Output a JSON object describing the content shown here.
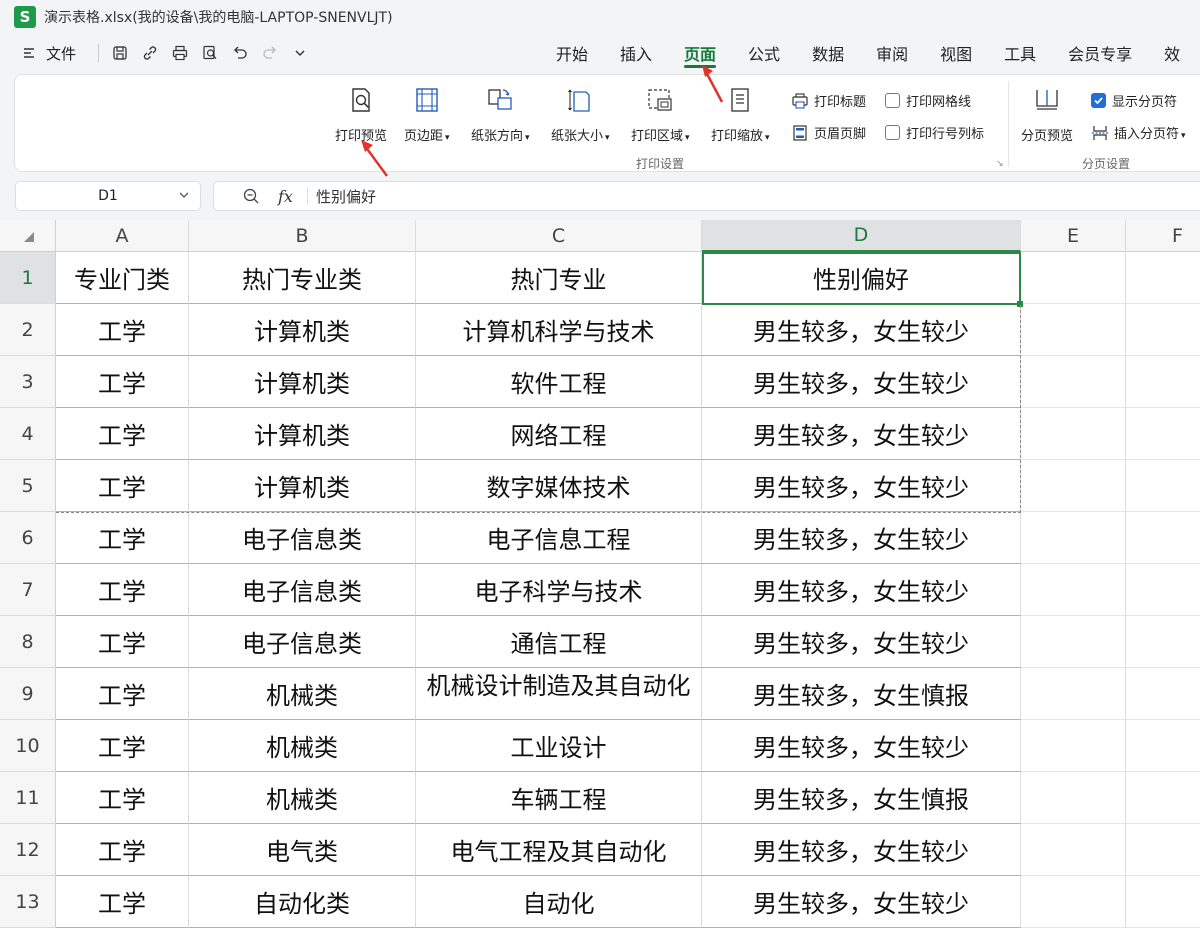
{
  "window": {
    "app_letter": "S",
    "title": "演示表格.xlsx(我的设备\\我的电脑-LAPTOP-SNENVLJT)"
  },
  "menu": {
    "file_label": "文件",
    "tabs": [
      "开始",
      "插入",
      "页面",
      "公式",
      "数据",
      "审阅",
      "视图",
      "工具",
      "会员专享",
      "效"
    ]
  },
  "ribbon": {
    "print_preview": "打印预览",
    "margins": "页边距",
    "orientation": "纸张方向",
    "paper_size": "纸张大小",
    "print_area": "打印区域",
    "print_scale": "打印缩放",
    "print_titles": "打印标题",
    "header_footer": "页眉页脚",
    "print_gridlines": "打印网格线",
    "print_row_col_headers": "打印行号列标",
    "print_group": "打印设置",
    "page_break_preview": "分页预览",
    "show_page_breaks": "显示分页符",
    "insert_page_break": "插入分页符",
    "break_group": "分页设置",
    "show_page_breaks_checked": true,
    "print_gridlines_checked": false,
    "print_row_col_headers_checked": false
  },
  "formula_bar": {
    "cell_ref": "D1",
    "fx_label": "fx",
    "content": "性别偏好"
  },
  "sheet": {
    "columns": [
      "A",
      "B",
      "C",
      "D",
      "E",
      "F"
    ],
    "selected_column": "D",
    "selected_row": "1",
    "rows": [
      {
        "num": "1",
        "cells": [
          "专业门类",
          "热门专业类",
          "热门专业",
          "性别偏好"
        ]
      },
      {
        "num": "2",
        "cells": [
          "工学",
          "计算机类",
          "计算机科学与技术",
          "男生较多，女生较少"
        ]
      },
      {
        "num": "3",
        "cells": [
          "工学",
          "计算机类",
          "软件工程",
          "男生较多，女生较少"
        ]
      },
      {
        "num": "4",
        "cells": [
          "工学",
          "计算机类",
          "网络工程",
          "男生较多，女生较少"
        ]
      },
      {
        "num": "5",
        "cells": [
          "工学",
          "计算机类",
          "数字媒体技术",
          "男生较多，女生较少"
        ]
      },
      {
        "num": "6",
        "cells": [
          "工学",
          "电子信息类",
          "电子信息工程",
          "男生较多，女生较少"
        ]
      },
      {
        "num": "7",
        "cells": [
          "工学",
          "电子信息类",
          "电子科学与技术",
          "男生较多，女生较少"
        ]
      },
      {
        "num": "8",
        "cells": [
          "工学",
          "电子信息类",
          "通信工程",
          "男生较多，女生较少"
        ]
      },
      {
        "num": "9",
        "cells": [
          "工学",
          "机械类",
          "机械设计制造及其自动化",
          "男生较多，女生慎报"
        ]
      },
      {
        "num": "10",
        "cells": [
          "工学",
          "机械类",
          "工业设计",
          "男生较多，女生较少"
        ]
      },
      {
        "num": "11",
        "cells": [
          "工学",
          "机械类",
          "车辆工程",
          "男生较多，女生慎报"
        ]
      },
      {
        "num": "12",
        "cells": [
          "工学",
          "电气类",
          "电气工程及其自动化",
          "男生较多，女生较少"
        ]
      },
      {
        "num": "13",
        "cells": [
          "工学",
          "自动化类",
          "自动化",
          "男生较多，女生较少"
        ]
      }
    ]
  }
}
